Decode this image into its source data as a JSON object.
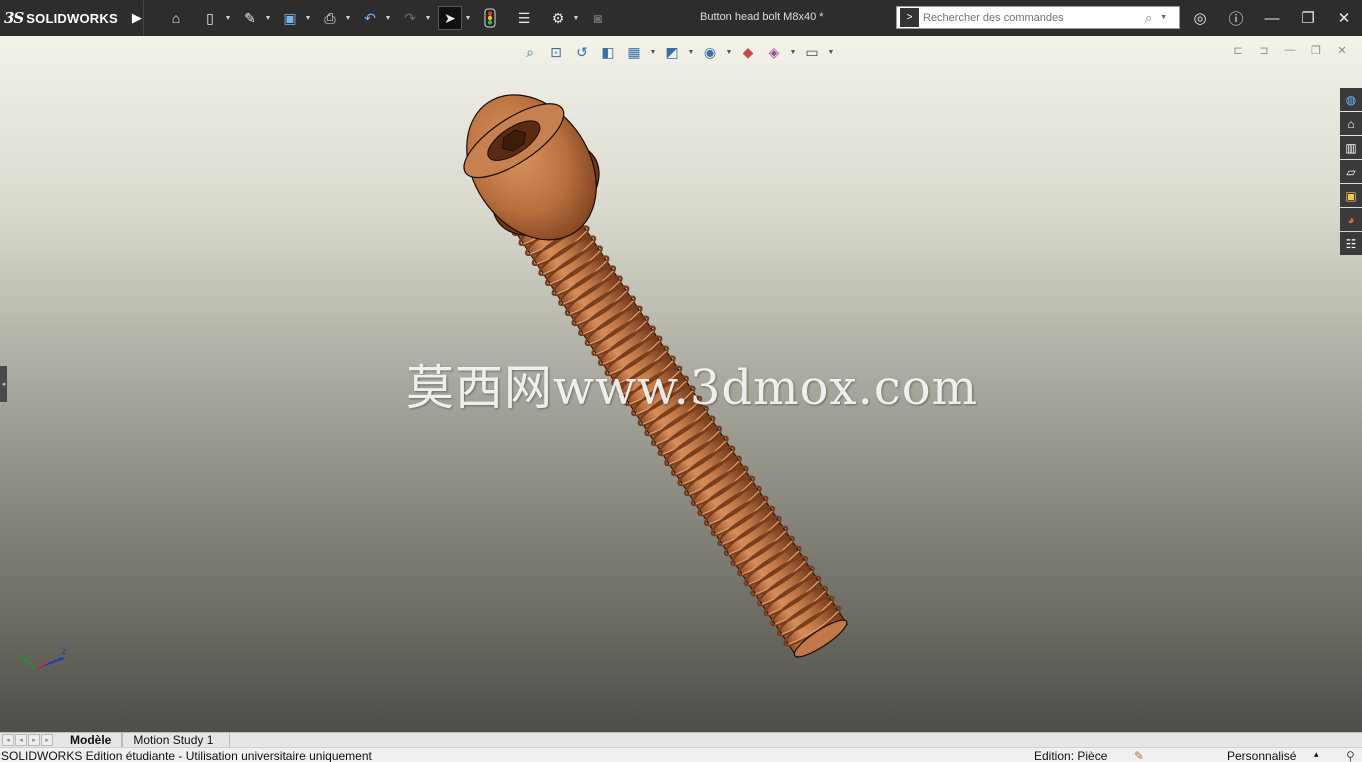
{
  "app": {
    "brand": "SOLIDWORKS",
    "brand_mark": "3S",
    "document_title": "Button head bolt M8x40 *"
  },
  "toolbar": {
    "items": [
      {
        "name": "home-icon",
        "glyph": "⌂"
      },
      {
        "name": "new-document-icon",
        "glyph": "🗋"
      },
      {
        "name": "open-icon",
        "glyph": "✎"
      },
      {
        "name": "save-icon",
        "glyph": "▣"
      },
      {
        "name": "print-icon",
        "glyph": "⎙"
      },
      {
        "name": "undo-icon",
        "glyph": "↶"
      },
      {
        "name": "redo-icon",
        "glyph": "↷"
      },
      {
        "name": "select-icon",
        "glyph": "➤"
      },
      {
        "name": "rebuild-icon",
        "glyph": "●"
      },
      {
        "name": "file-properties-icon",
        "glyph": "☰"
      },
      {
        "name": "options-icon",
        "glyph": "⚙"
      },
      {
        "name": "camera-icon",
        "glyph": "◙"
      }
    ]
  },
  "search": {
    "placeholder": "Rechercher des commandes"
  },
  "watermark": "莫西网www.3dmox.com",
  "tabs": {
    "model": "Modèle",
    "motion_study": "Motion Study 1"
  },
  "status": {
    "left": "SOLIDWORKS Edition étudiante - Utilisation universitaire uniquement",
    "mode": "Edition: Pièce",
    "units": "Personnalisé",
    "units_arrow": "▴"
  },
  "colors": {
    "bolt_main": "#c07848",
    "bolt_dark": "#7a3e1c",
    "bolt_light": "#e3a06e",
    "titlebar": "#2d2d2d"
  }
}
